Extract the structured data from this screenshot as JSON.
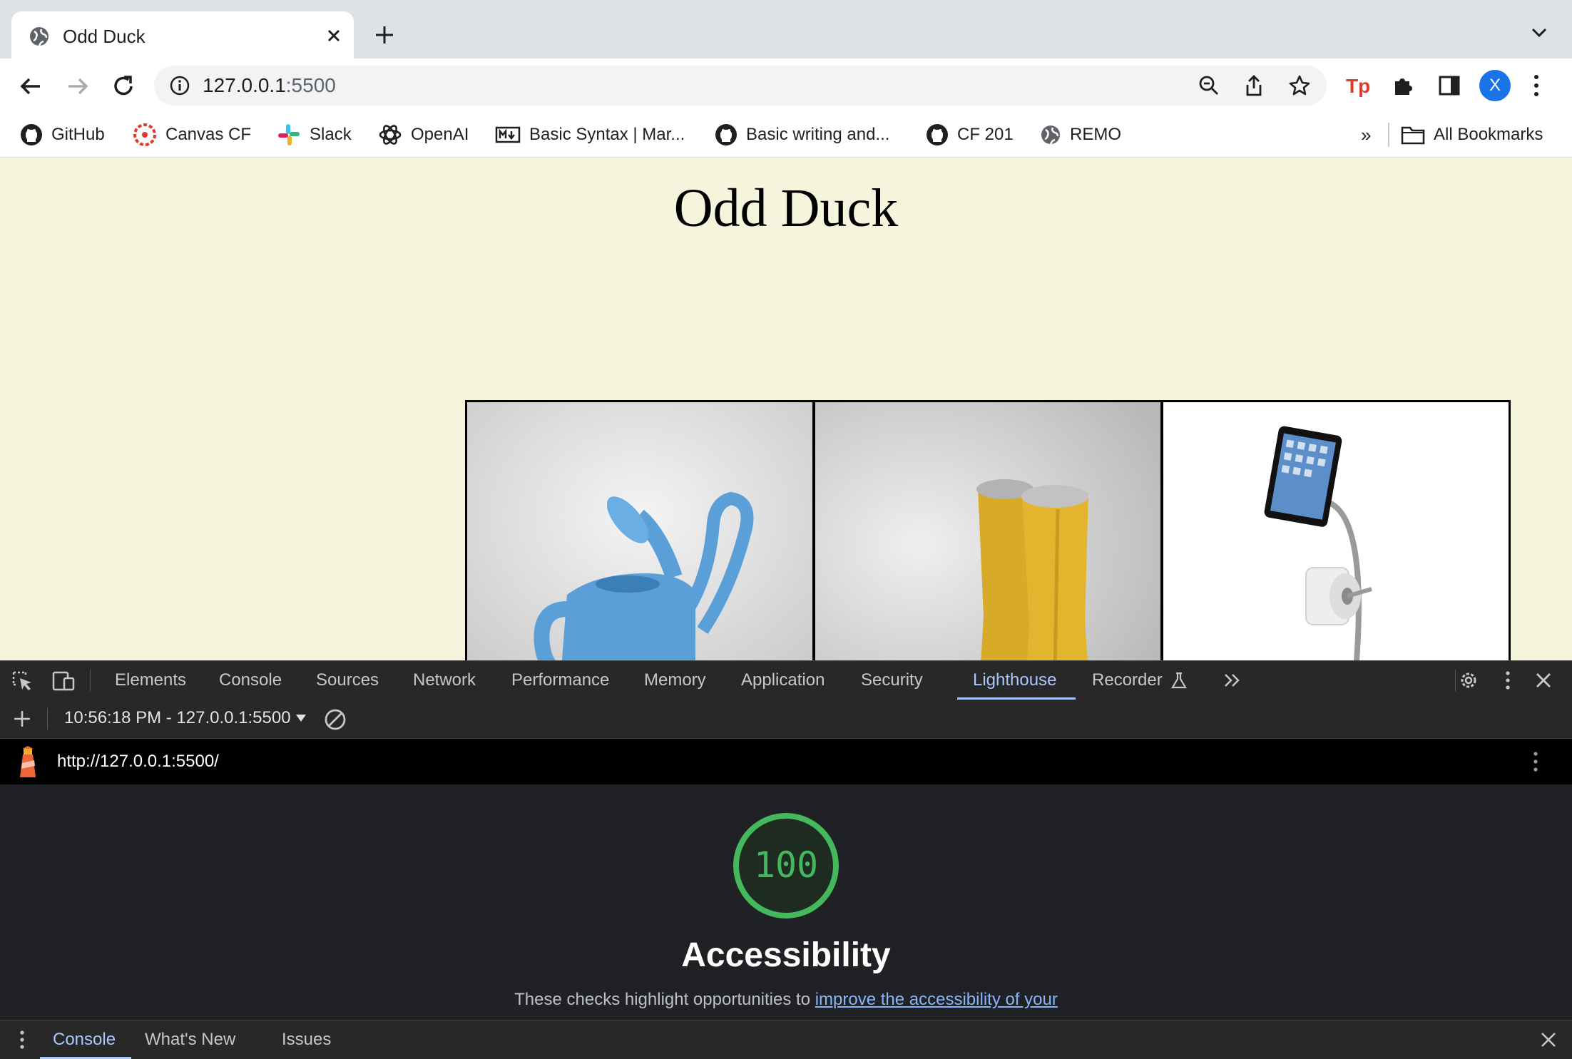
{
  "browser": {
    "tab_title": "Odd Duck",
    "url_host": "127.0.0.1",
    "url_port": ":5500"
  },
  "bookmarks": [
    {
      "label": "GitHub",
      "icon": "github-icon"
    },
    {
      "label": "Canvas CF",
      "icon": "canvas-icon"
    },
    {
      "label": "Slack",
      "icon": "slack-icon"
    },
    {
      "label": "OpenAI",
      "icon": "openai-icon"
    },
    {
      "label": "Basic Syntax | Mar...",
      "icon": "markdown-icon"
    },
    {
      "label": "Basic writing and...",
      "icon": "github-icon"
    },
    {
      "label": "CF 201",
      "icon": "github-icon"
    },
    {
      "label": "REMO",
      "icon": "globe-icon"
    }
  ],
  "bookmarks_overflow": "»",
  "all_bookmarks": "All Bookmarks",
  "profile_initial": "X",
  "page": {
    "title": "Odd Duck",
    "products": [
      "watering-can",
      "boots",
      "tablet-stand"
    ]
  },
  "devtools": {
    "tabs": [
      "Elements",
      "Console",
      "Sources",
      "Network",
      "Performance",
      "Memory",
      "Application",
      "Security",
      "Lighthouse",
      "Recorder"
    ],
    "active_tab": "Lighthouse",
    "report_selector": "10:56:18 PM - 127.0.0.1:5500",
    "lighthouse_url": "http://127.0.0.1:5500/",
    "score": "100",
    "category": "Accessibility",
    "description_prefix": "These checks highlight opportunities to ",
    "description_link": "improve the accessibility of your",
    "drawer_tabs": [
      "Console",
      "What's New",
      "Issues"
    ],
    "drawer_active": "Console"
  },
  "colors": {
    "page_bg": "#f5f4dd",
    "score_green": "#43b85c",
    "active_blue": "#a8c7fa"
  }
}
